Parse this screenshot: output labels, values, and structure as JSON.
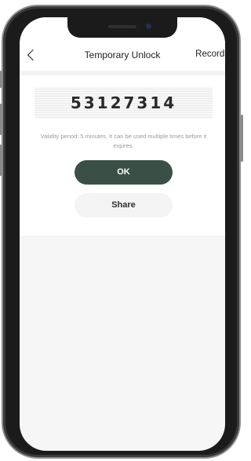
{
  "header": {
    "title": "Temporary Unlock",
    "records_label": "Records",
    "back_icon": "chevron-left-icon"
  },
  "code": {
    "value": "53127314"
  },
  "validity": {
    "text": "Validity period: 5 minutes. It can be used multiple times before it expires."
  },
  "actions": {
    "ok_label": "OK",
    "share_label": "Share"
  },
  "colors": {
    "primary_button": "#3a5047",
    "secondary_button": "#f4f4f4",
    "background": "#f6f6f6"
  }
}
